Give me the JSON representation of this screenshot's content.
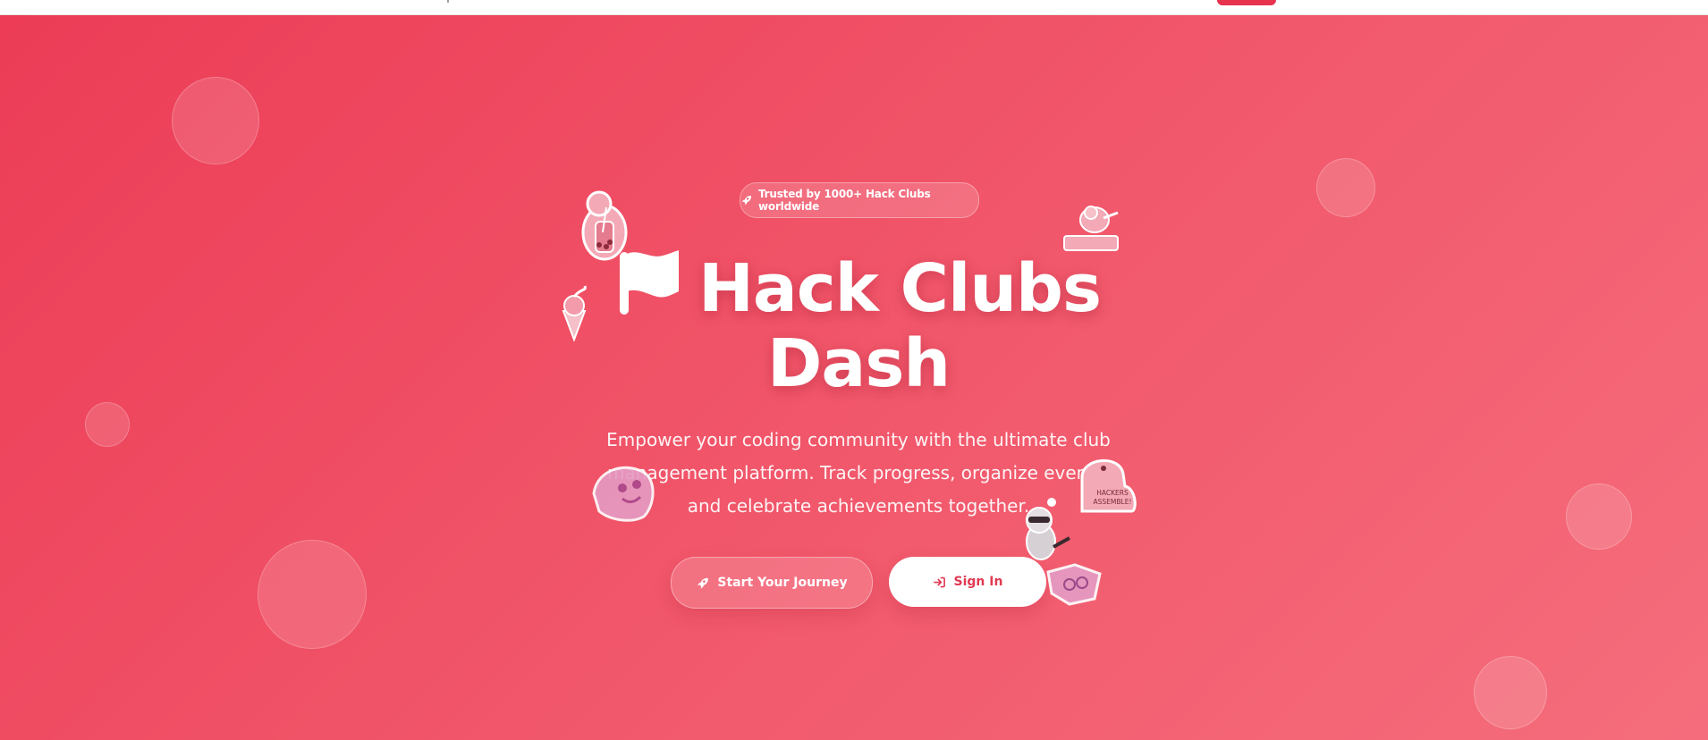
{
  "badge": {
    "text": "Trusted by 1000+ Hack Clubs worldwide",
    "icon": "rocket-icon"
  },
  "hero": {
    "title_line1": "Hack Clubs",
    "title_line2": "Dash",
    "subtitle": "Empower your coding community with the ultimate club management platform. Track progress, organize events, and celebrate achievements together."
  },
  "buttons": {
    "journey_label": "Start Your Journey",
    "signin_label": "Sign In"
  },
  "stickers": {
    "hackers_assemble": "HACKERS ASSEMBLE!"
  },
  "colors": {
    "accent": "#ef4a5f",
    "signin_text": "#e13a52",
    "topbar_button": "#e8334f"
  }
}
